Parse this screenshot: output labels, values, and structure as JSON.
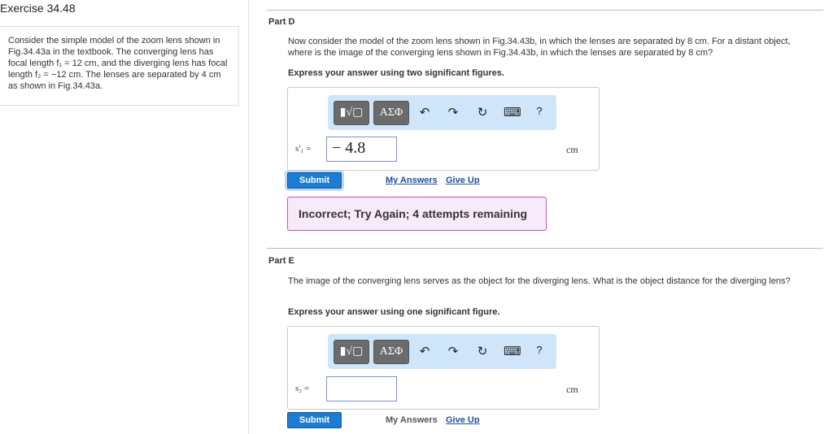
{
  "exercise_title": "Exercise 34.48",
  "problem_text": "Consider the simple model of the zoom lens shown in Fig.34.43a in the textbook. The converging lens has focal length f₁ = 12 cm, and the diverging lens has focal length f₂ = −12 cm. The lenses are separated by 4 cm as shown in Fig.34.43a.",
  "toolbar": {
    "template_label": "▮√▢",
    "greek_label": "ΑΣΦ",
    "undo": "↶",
    "redo": "↷",
    "reset": "↻",
    "keyboard": "⌨",
    "help": "?"
  },
  "partD": {
    "label": "Part D",
    "question": "Now consider the model of the zoom lens shown in Fig.34.43b, in which the lenses are separated by 8 cm. For a distant object, where is the image of the converging lens shown in Fig.34.43b, in which the lenses are separated by 8 cm?",
    "instruction": "Express your answer using two significant figures.",
    "var_label": "s′₁ =",
    "value": "− 4.8",
    "unit": "cm",
    "submit": "Submit",
    "my_answers": "My Answers",
    "give_up": "Give Up",
    "feedback": "Incorrect; Try Again; 4 attempts remaining"
  },
  "partE": {
    "label": "Part E",
    "question": "The image of the converging lens serves as the object for the diverging lens. What is the object distance for the diverging lens?",
    "instruction": "Express your answer using one significant figure.",
    "var_label": "s₂ =",
    "value": "",
    "unit": "cm",
    "submit": "Submit",
    "my_answers": "My Answers",
    "give_up": "Give Up"
  }
}
